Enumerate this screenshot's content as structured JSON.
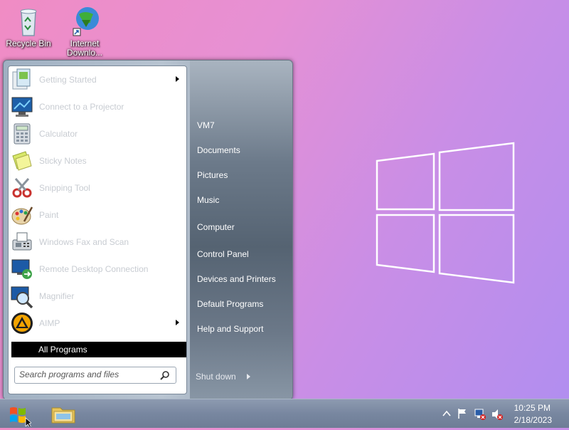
{
  "desktop": {
    "icons": [
      {
        "label": "Recycle Bin"
      },
      {
        "label_line1": "Internet",
        "label_line2": "Downlo..."
      }
    ]
  },
  "start_menu": {
    "programs": [
      {
        "label": "Getting Started",
        "icon": "getting-started-icon",
        "has_submenu": true
      },
      {
        "label": "Connect to a Projector",
        "icon": "projector-icon",
        "has_submenu": false
      },
      {
        "label": "Calculator",
        "icon": "calculator-icon",
        "has_submenu": false
      },
      {
        "label": "Sticky Notes",
        "icon": "sticky-notes-icon",
        "has_submenu": false
      },
      {
        "label": "Snipping Tool",
        "icon": "scissors-icon",
        "has_submenu": false
      },
      {
        "label": "Paint",
        "icon": "palette-icon",
        "has_submenu": false
      },
      {
        "label": "Windows Fax and Scan",
        "icon": "fax-icon",
        "has_submenu": false
      },
      {
        "label": "Remote Desktop Connection",
        "icon": "remote-desktop-icon",
        "has_submenu": false
      },
      {
        "label": "Magnifier",
        "icon": "magnifier-icon",
        "has_submenu": false
      },
      {
        "label": "AIMP",
        "icon": "aimp-icon",
        "has_submenu": true
      }
    ],
    "all_programs": "All Programs",
    "search_placeholder": "Search programs and files",
    "right_items": [
      "VM7",
      "Documents",
      "Pictures",
      "Music",
      "Computer",
      "Control Panel",
      "Devices and Printers",
      "Default Programs",
      "Help and Support"
    ],
    "shutdown": "Shut down"
  },
  "taskbar": {
    "clock_time": "10:25 PM",
    "clock_date": "2/18/2023"
  },
  "colors": {
    "accent": "#000000",
    "desktop_pink": "#f08cc4",
    "desktop_purple": "#b08ef0"
  }
}
